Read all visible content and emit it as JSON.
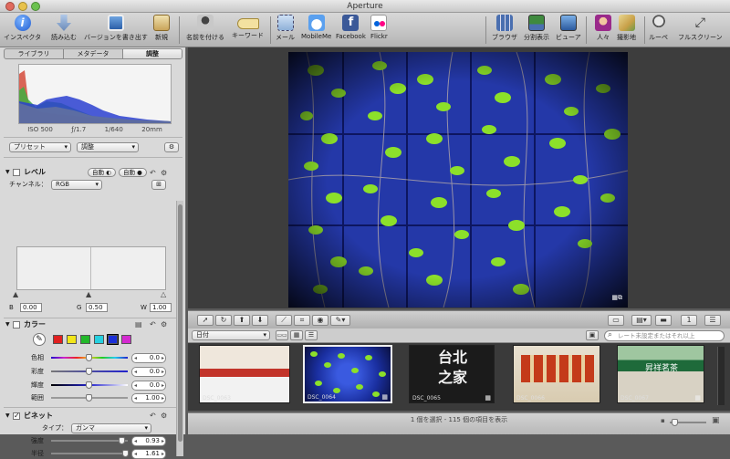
{
  "window": {
    "title": "Aperture"
  },
  "toolbar": {
    "inspector": "インスペクタ",
    "import": "読み込む",
    "export_version": "バージョンを書き出す",
    "new": "新規",
    "name": "名前を付ける",
    "keyword": "キーワード",
    "mail": "メール",
    "mobileme": "MobileMe",
    "facebook": "Facebook",
    "flickr": "Flickr",
    "browser": "ブラウザ",
    "split_view": "分割表示",
    "viewer": "ビューア",
    "faces": "人々",
    "places": "撮影地",
    "loupe": "ルーペ",
    "fullscreen": "フルスクリーン"
  },
  "inspector": {
    "tabs": [
      "ライブラリ",
      "メタデータ",
      "調整"
    ],
    "exif": {
      "iso": "ISO 500",
      "aperture": "ƒ/1.7",
      "shutter": "1/640",
      "focal": "20mm"
    },
    "preset_label": "プリセット",
    "adjust_label": "調整",
    "levels": {
      "title": "レベル",
      "auto1": "自動",
      "auto2": "自動",
      "channel_label": "チャンネル：",
      "channel_value": "RGB",
      "b_label": "B",
      "b_value": "0.00",
      "g_label": "G",
      "g_value": "0.50",
      "w_label": "W",
      "w_value": "1.00"
    },
    "color": {
      "title": "カラー",
      "swatches": [
        "#e02020",
        "#f2e61a",
        "#22b82a",
        "#26d0e0",
        "#1a2fd8",
        "#d42ad0"
      ],
      "sliders": [
        {
          "label": "色相",
          "value": "0.0",
          "pos": 0.5
        },
        {
          "label": "彩度",
          "value": "0.0",
          "pos": 0.5
        },
        {
          "label": "輝度",
          "value": "0.0",
          "pos": 0.5
        },
        {
          "label": "範囲",
          "value": "1.00",
          "pos": 0.5
        }
      ]
    },
    "vignette": {
      "title": "ビネット",
      "type_label": "タイプ：",
      "type_value": "ガンマ",
      "sliders": [
        {
          "label": "強度",
          "value": "0.93",
          "pos": 0.93
        },
        {
          "label": "半径",
          "value": "1.61",
          "pos": 0.97
        }
      ]
    }
  },
  "browser": {
    "sort_label": "日付",
    "search_placeholder": "レート未設定またはそれ以上",
    "thumbnails": [
      {
        "label": "DSC_0063",
        "kind": "storefront",
        "selected": false
      },
      {
        "label": "DSC_0064",
        "kind": "vines",
        "selected": true
      },
      {
        "label": "DSC_0065",
        "kind": "sign",
        "selected": false
      },
      {
        "label": "DSC_0066",
        "kind": "shelves",
        "selected": false
      },
      {
        "label": "DSC_0067",
        "kind": "teashop",
        "selected": false
      }
    ],
    "thumb_text": {
      "sign": "台北\n之家",
      "teashop": "昇祥茗茶"
    }
  },
  "status": {
    "text": "1 個を選択 - 115 個の項目を表示"
  }
}
